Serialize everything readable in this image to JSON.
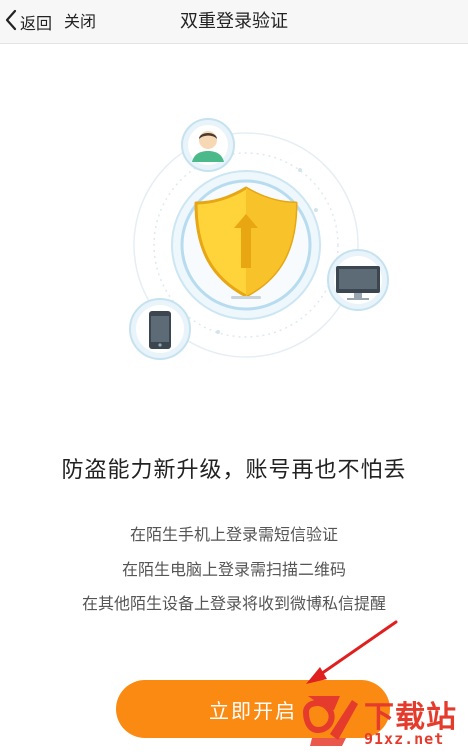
{
  "nav": {
    "back_label": "返回",
    "close_label": "关闭",
    "title": "双重登录验证"
  },
  "illustration": {
    "icons": [
      "user-avatar-icon",
      "shield-icon",
      "monitor-icon",
      "smartphone-icon"
    ],
    "colors": {
      "ring": "#cde6f3",
      "shield": "#ffd43a",
      "shield_outline": "#e7a614",
      "accent": "#6fb8e0"
    }
  },
  "content": {
    "headline": "防盗能力新升级，账号再也不怕丢",
    "descriptions": [
      "在陌生手机上登录需短信验证",
      "在陌生电脑上登录需扫描二维码",
      "在其他陌生设备上登录将收到微博私信提醒"
    ]
  },
  "action": {
    "enable_label": "立即开启",
    "color": "#fb8a12"
  },
  "watermark": {
    "brand": "下载站",
    "url": "91xz.net",
    "color": "#e53b2c"
  }
}
